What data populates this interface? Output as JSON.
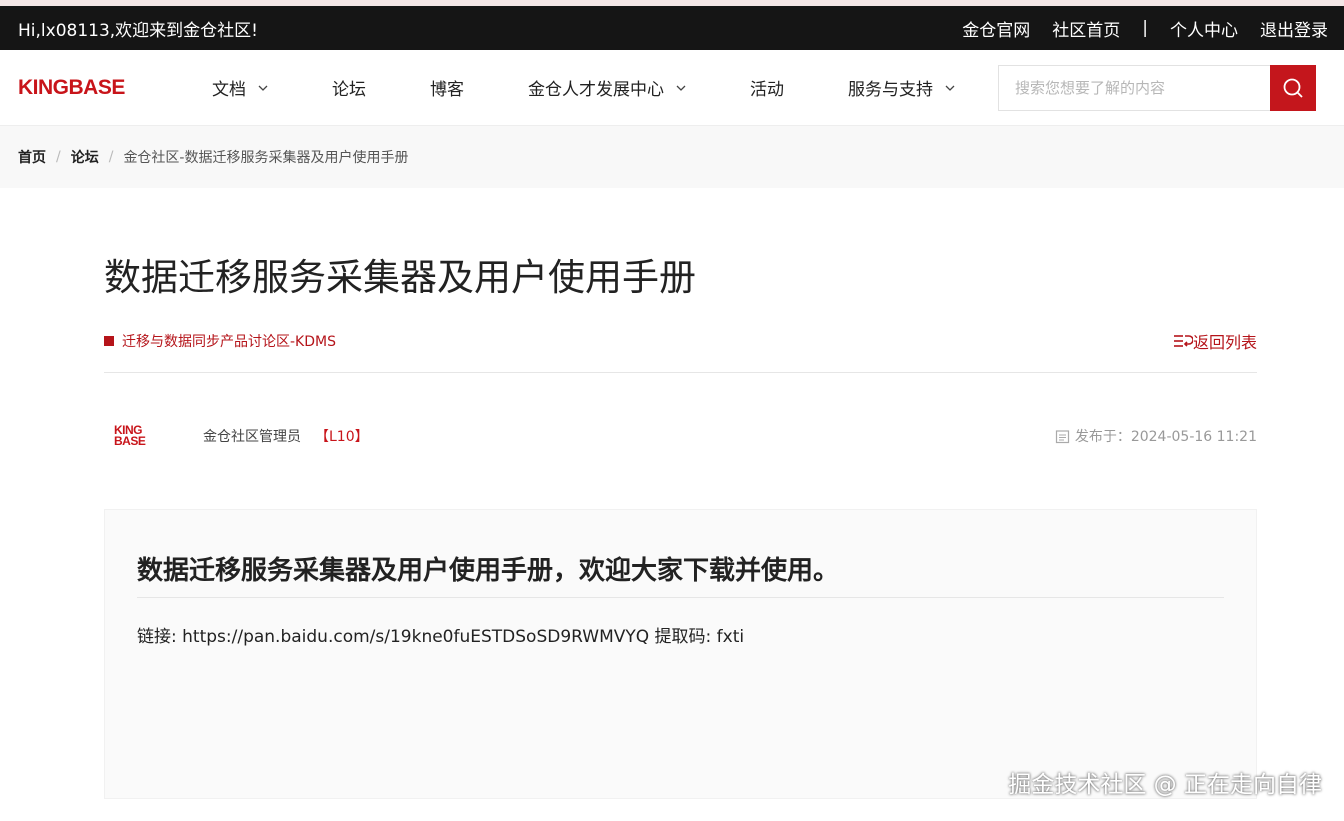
{
  "topbar": {
    "greeting": "Hi,lx08113,欢迎来到金仓社区!",
    "links": [
      "金仓官网",
      "社区首页",
      "|",
      "个人中心",
      "退出登录"
    ]
  },
  "nav": {
    "logo": "KINGBASE",
    "menu": [
      {
        "label": "文档",
        "dropdown": true
      },
      {
        "label": "论坛",
        "dropdown": false
      },
      {
        "label": "博客",
        "dropdown": false
      },
      {
        "label": "金仓人才发展中心",
        "dropdown": true
      },
      {
        "label": "活动",
        "dropdown": false
      },
      {
        "label": "服务与支持",
        "dropdown": true
      }
    ],
    "search_placeholder": "搜索您想要了解的内容"
  },
  "breadcrumb": {
    "home": "首页",
    "forum": "论坛",
    "current": "金仓社区-数据迁移服务采集器及用户使用手册"
  },
  "post": {
    "title": "数据迁移服务采集器及用户使用手册",
    "category": "迁移与数据同步产品讨论区-KDMS",
    "back_label": "返回列表",
    "author_avatar_top": "KING",
    "author_avatar_bottom": "BASE",
    "author": "金仓社区管理员",
    "level": "【L10】",
    "date": "发布于：2024-05-16 11:21",
    "body_heading": "数据迁移服务采集器及用户使用手册，欢迎大家下载并使用。",
    "body_text": "链接: https://pan.baidu.com/s/19kne0fuESTDSoSD9RWMVYQ 提取码: fxti"
  },
  "watermark": "掘金技术社区 @ 正在走向自律",
  "colors": {
    "accent": "#c4161c",
    "topbar": "#151515",
    "breadcrumb_bg": "#f8f8f8"
  }
}
